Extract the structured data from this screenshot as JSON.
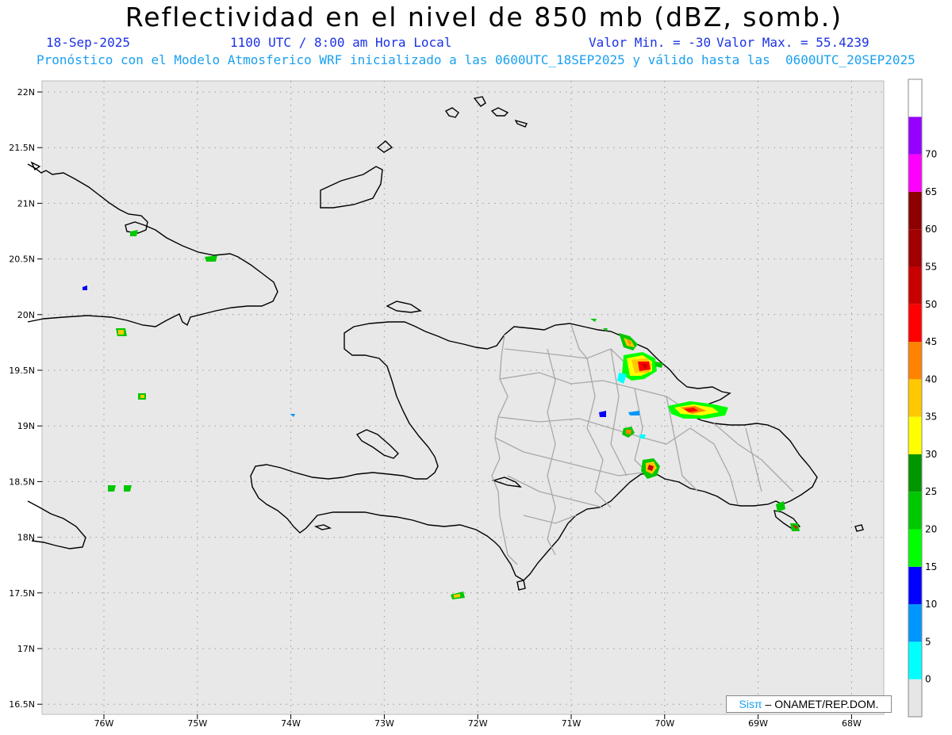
{
  "title": "Reflectividad en el nivel de 850 mb (dBZ, somb.)",
  "date": "18-Sep-2025",
  "time": "1100 UTC / 8:00 am Hora Local",
  "valmin": "Valor Min. = -30",
  "valmax": "Valor Max. = 55.4239",
  "forecast": "Pronóstico con el Modelo Atmosferico WRF inicializado a las 0600UTC_18SEP2025 y válido hasta las  0600UTC_20SEP2025",
  "credit": {
    "sis": "Sisπ",
    "rest": " – ONAMET/REP.DOM."
  },
  "axes": {
    "lat_labels": [
      "22N",
      "21.5N",
      "21N",
      "20.5N",
      "20N",
      "19.5N",
      "19N",
      "18.5N",
      "18N",
      "17.5N",
      "17N",
      "16.5N"
    ],
    "lon_labels": [
      "76W",
      "75W",
      "74W",
      "73W",
      "72W",
      "71W",
      "70W",
      "69W",
      "68W"
    ]
  },
  "colorbar": {
    "labels": [
      "0",
      "5",
      "10",
      "15",
      "20",
      "25",
      "30",
      "35",
      "40",
      "45",
      "50",
      "55",
      "60",
      "65",
      "70"
    ],
    "colors": [
      "#e6e6e6",
      "#00ffff",
      "#0096ff",
      "#0000ff",
      "#00ff00",
      "#00c800",
      "#009600",
      "#ffff00",
      "#ffc800",
      "#ff8200",
      "#ff0000",
      "#c80000",
      "#a00000",
      "#8c0000",
      "#ff00ff",
      "#9600ff",
      "#ffffff"
    ]
  }
}
